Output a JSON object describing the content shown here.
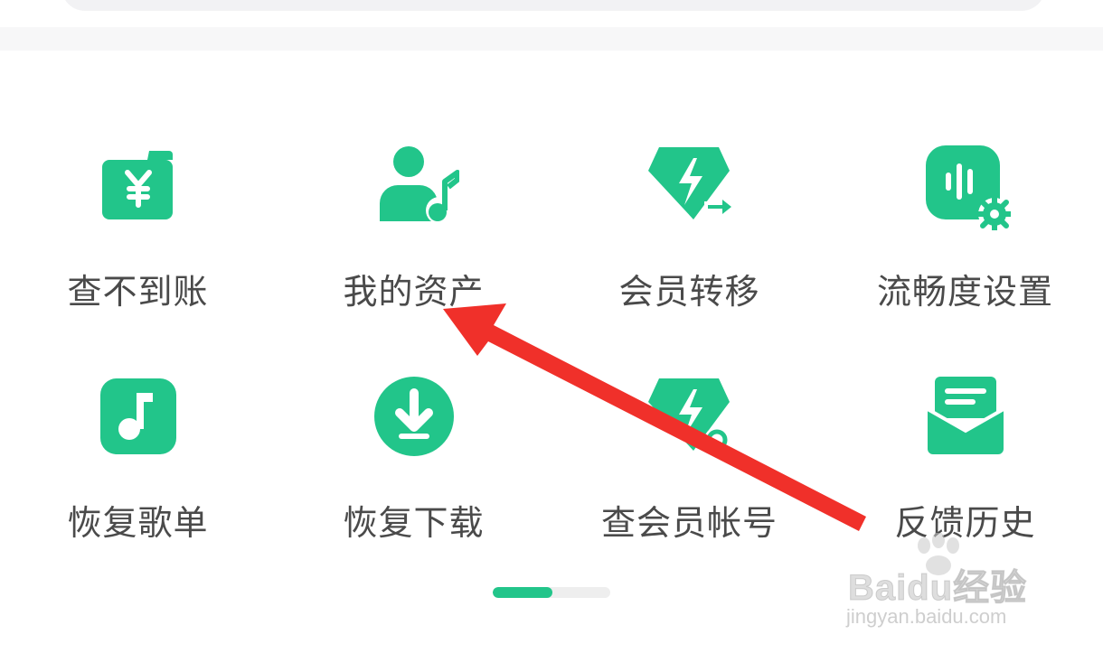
{
  "colors": {
    "accent": "#22c58a",
    "label_text": "#4a4a4a",
    "annotation_arrow": "#f0302a"
  },
  "grid": {
    "items": [
      {
        "label": "查不到账",
        "icon": "wallet-yuan-icon"
      },
      {
        "label": "我的资产",
        "icon": "user-music-icon"
      },
      {
        "label": "会员转移",
        "icon": "diamond-transfer-icon"
      },
      {
        "label": "流畅度设置",
        "icon": "audio-settings-icon"
      },
      {
        "label": "恢复歌单",
        "icon": "music-note-icon"
      },
      {
        "label": "恢复下载",
        "icon": "download-icon"
      },
      {
        "label": "查会员帐号",
        "icon": "diamond-search-icon"
      },
      {
        "label": "反馈历史",
        "icon": "mail-icon"
      }
    ]
  },
  "pager": {
    "pages": 2,
    "current": 1
  },
  "watermark": {
    "brand": "Baidu经验",
    "url": "jingyan.baidu.com"
  }
}
